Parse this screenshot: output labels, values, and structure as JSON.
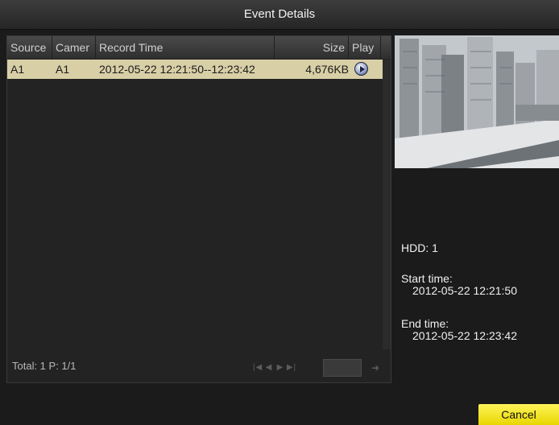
{
  "window": {
    "title": "Event Details"
  },
  "table": {
    "columns": {
      "source": "Source",
      "camera": "Camer",
      "record_time": "Record Time",
      "size": "Size",
      "play": "Play"
    },
    "rows": [
      {
        "source": "A1",
        "camera": "A1",
        "record_time": "2012-05-22 12:21:50--12:23:42",
        "size": "4,676KB",
        "play_icon": "play-circle-icon"
      }
    ],
    "selected_row_color": "#d9cfa7"
  },
  "footer": {
    "total": "Total: 1  P: 1/1",
    "pager_icons": [
      "first-page-icon",
      "prev-page-icon",
      "next-page-icon",
      "last-page-icon",
      "go-icon"
    ],
    "page_input_value": ""
  },
  "details": {
    "hdd": "HDD: 1",
    "start_label": "Start time:",
    "start_value": "2012-05-22 12:21:50",
    "end_label": "End time:",
    "end_value": "2012-05-22 12:23:42"
  },
  "buttons": {
    "cancel": "Cancel"
  },
  "colors": {
    "accent_button": "#fff200",
    "background": "#1b1b1b"
  }
}
